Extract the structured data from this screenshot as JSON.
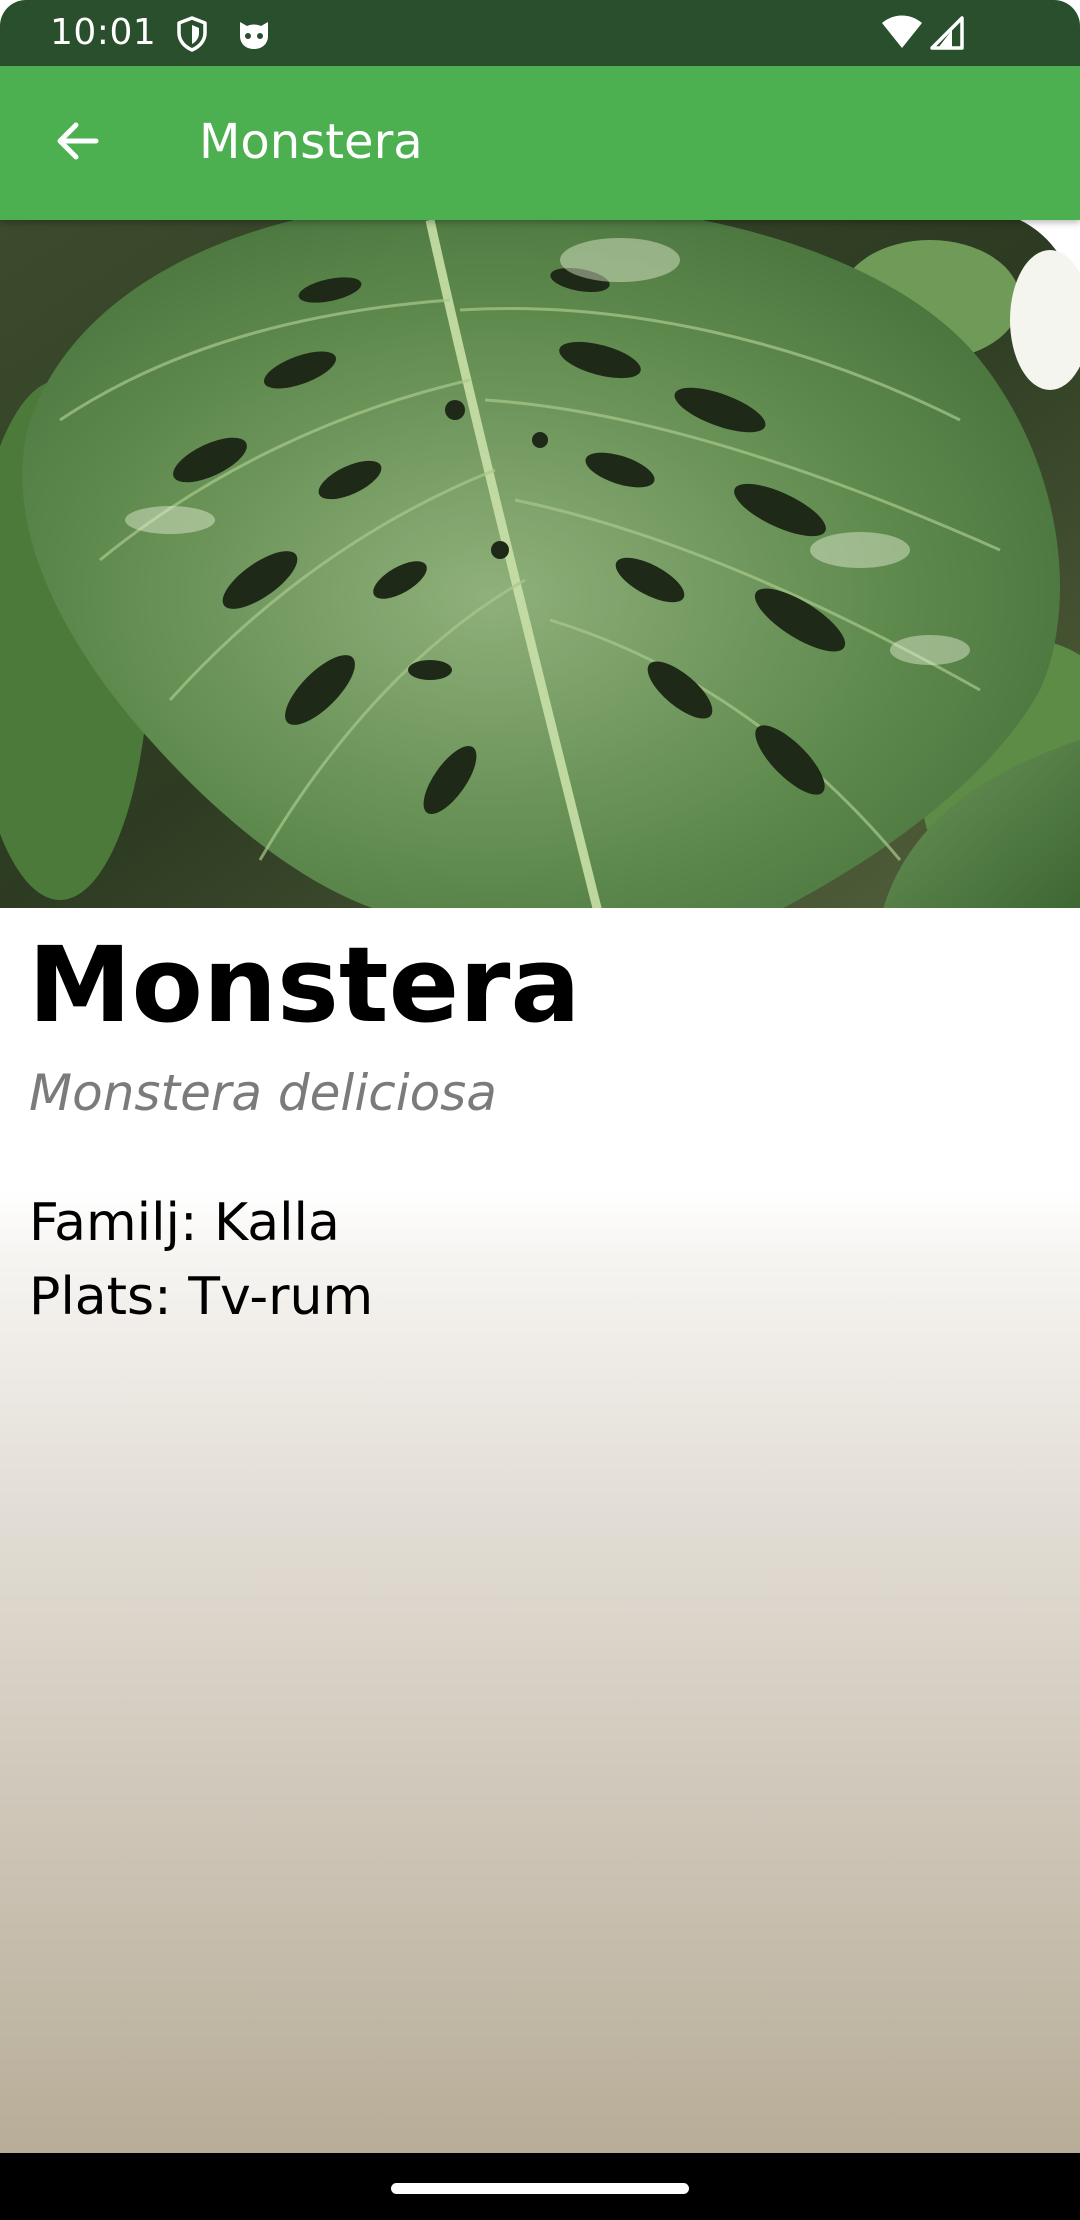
{
  "status_bar": {
    "time": "10:01",
    "left_icons": [
      "shield-icon",
      "cat-face-icon"
    ],
    "right_icons": [
      "wifi-icon",
      "cell-signal-icon"
    ]
  },
  "app_bar": {
    "back_icon": "arrow-back-icon",
    "title": "Monstera",
    "color": "#4caf50"
  },
  "hero_image": {
    "subject": "monstera-leaf-photo"
  },
  "plant": {
    "name": "Monstera",
    "latin_name": "Monstera deliciosa",
    "details": [
      {
        "text": "Familj: Kalla"
      },
      {
        "text": "Plats: Tv-rum"
      }
    ]
  },
  "colors": {
    "status_bar": "#2a4f2c",
    "app_bar": "#4caf50",
    "latin_text": "#7b7b7b"
  }
}
